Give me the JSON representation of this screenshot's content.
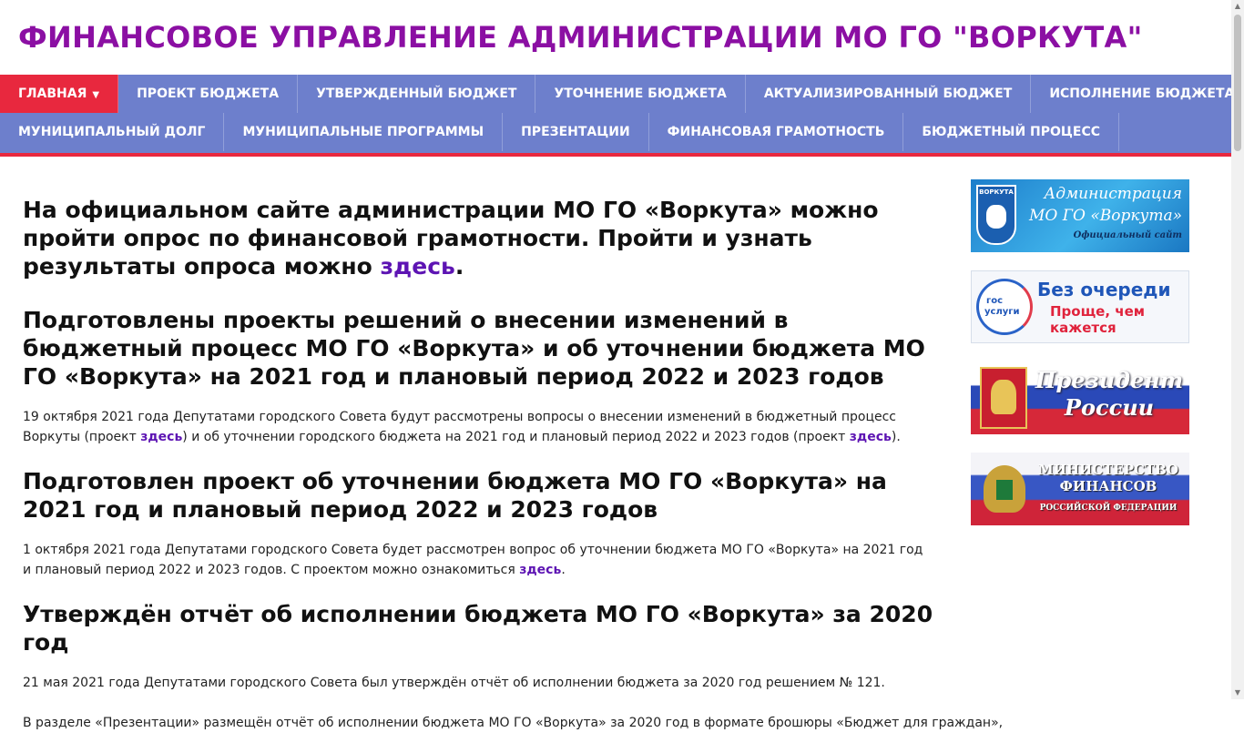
{
  "site": {
    "title": "ФИНАНСОВОЕ УПРАВЛЕНИЕ АДМИНИСТРАЦИИ МО ГО \"ВОРКУТА\""
  },
  "nav": {
    "row1": [
      "Главная",
      "Проект бюджета",
      "Утвержденный бюджет",
      "Уточнение бюджета",
      "Актуализированный бюджет",
      "Исполнение бюджета"
    ],
    "row2": [
      "Муниципальный долг",
      "Муниципальные программы",
      "Презентации",
      "Финансовая грамотность",
      "Бюджетный процесс"
    ],
    "active_index": 0
  },
  "posts": [
    {
      "title_a": "На официальном сайте администрации МО ГО «Воркута» можно пройти опрос по финансовой грамотности. Пройти и узнать результаты опроса можно ",
      "title_link": "здесь",
      "title_b": "."
    },
    {
      "title": "Подготовлены проекты решений о внесении изменений в бюджетный процесс МО ГО «Воркута» и об уточнении бюджета МО ГО «Воркута» на 2021 год и плановый период 2022 и 2023 годов",
      "p1": "19 октября 2021 года Депутатами городского Совета будут рассмотрены вопросы о внесении изменений в бюджетный процесс Воркуты (проект ",
      "link1": "здесь",
      "p2": ") и об уточнении городского бюджета на 2021 год и плановый период 2022 и 2023 годов (проект ",
      "link2": "здесь",
      "p3": ")."
    },
    {
      "title": "Подготовлен проект об уточнении бюджета МО ГО «Воркута» на 2021 год и плановый период 2022 и 2023 годов",
      "p1": "1 октября 2021 года Депутатами городского Совета будет рассмотрен вопрос об уточнении бюджета МО ГО «Воркута» на 2021 год и плановый период 2022 и 2023 годов. С проектом можно ознакомиться ",
      "link1": "здесь",
      "p2": "."
    },
    {
      "title": "Утверждён отчёт об исполнении бюджета МО ГО «Воркута» за 2020 год",
      "p1": "21 мая 2021 года Депутатами городского Совета был утверждён отчёт об исполнении бюджета за 2020 год решением № 121.",
      "p2": "В разделе «Презентации» размещён отчёт об исполнении бюджета МО ГО «Воркута» за 2020 год в формате брошюры «Бюджет для граждан»,"
    }
  ],
  "sidebar": {
    "admin": {
      "crest_label": "ВОРКУТА",
      "line1": "Администрация",
      "line2": "МО ГО «Воркута»",
      "line3": "Официальный сайт"
    },
    "gosuslugi": {
      "logo1": "гос",
      "logo2": "услуги",
      "line1": "Без очереди",
      "line2": "Проще, чем",
      "line3": "кажется"
    },
    "president": {
      "line1": "Президент",
      "line2": "России"
    },
    "minfin": {
      "line1": "МИНИСТЕРСТВО",
      "line2": "ФИНАНСОВ",
      "line3": "РОССИЙСКОЙ ФЕДЕРАЦИИ"
    }
  },
  "colors": {
    "title": "#8b0fa3",
    "nav": "#6d7fcc",
    "accent": "#e8283e",
    "link": "#5d14b3"
  }
}
